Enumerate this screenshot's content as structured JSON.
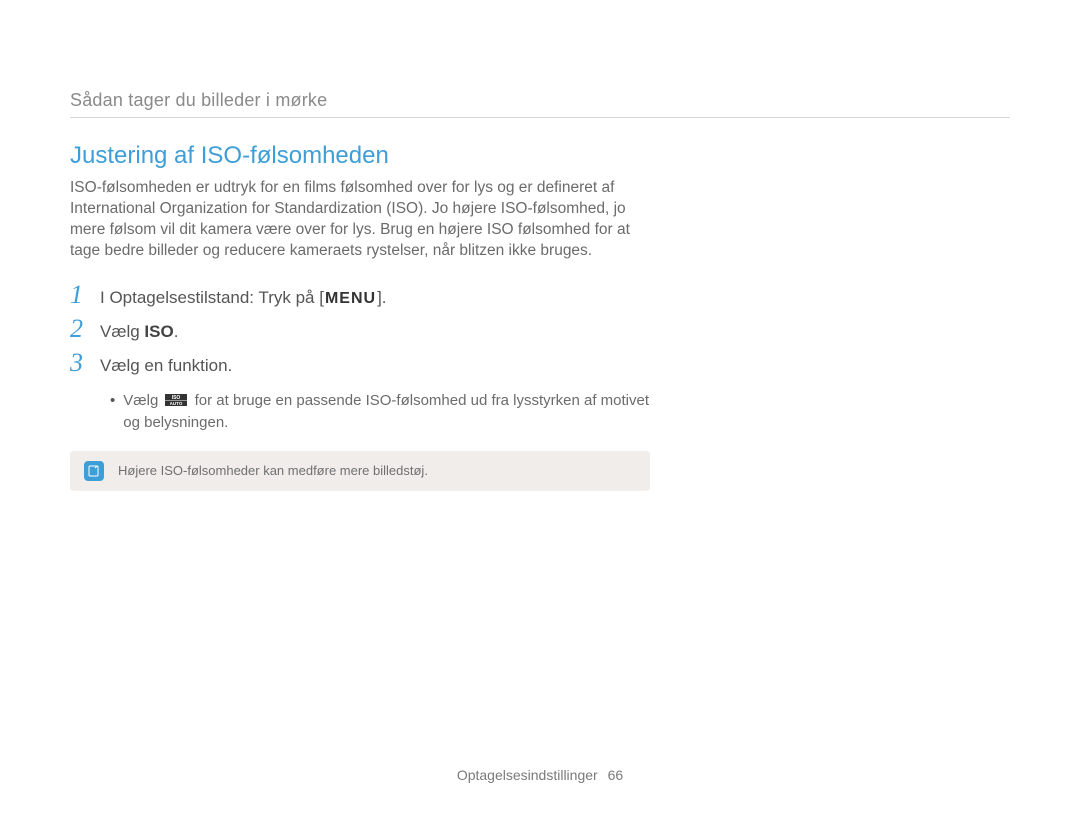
{
  "breadcrumb": "Sådan tager du billeder i mørke",
  "heading": "Justering af ISO-følsomheden",
  "intro": "ISO-følsomheden er udtryk for en films følsomhed over for lys og er defineret af International Organization for Standardization (ISO). Jo højere ISO-følsomhed, jo mere følsom vil dit kamera være over for lys. Brug en højere ISO følsomhed for at tage bedre billeder og reducere kameraets rystelser, når blitzen ikke bruges.",
  "steps": {
    "s1_num": "1",
    "s1_prefix": "I Optagelsestilstand: Tryk på [",
    "s1_menu": "MENU",
    "s1_suffix": "].",
    "s2_num": "2",
    "s2_prefix": "Vælg ",
    "s2_bold": "ISO",
    "s2_suffix": ".",
    "s3_num": "3",
    "s3_text": "Vælg en funktion."
  },
  "sub_bullet": {
    "prefix": "Vælg ",
    "icon_name": "ISO AUTO",
    "suffix": " for at bruge en passende ISO-følsomhed ud fra lysstyrken af motivet og belysningen."
  },
  "note": {
    "icon_label": "note",
    "text": "Højere ISO-følsomheder kan medføre mere billedstøj."
  },
  "footer": {
    "section": "Optagelsesindstillinger",
    "page": "66"
  }
}
